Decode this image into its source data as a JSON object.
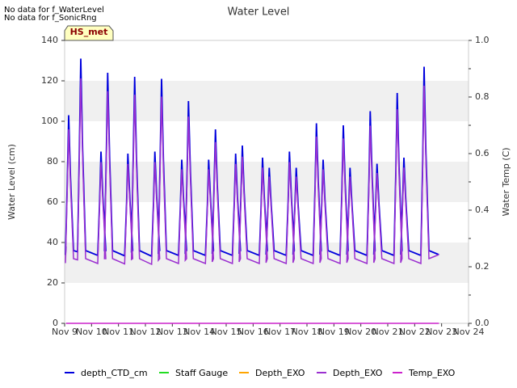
{
  "notices": [
    "No data for f_WaterLevel",
    "No data for f_SonicRng"
  ],
  "badge": "HS_met",
  "colors": {
    "depth_ctd": "#0000dd",
    "staff_gauge": "#22dd22",
    "depth_exo_orange": "#ffa500",
    "depth_exo_purple": "#9b30d0",
    "temp_exo": "#cc22cc",
    "band": "#f0f0f0",
    "badge_bg": "#ffffc0",
    "badge_text": "#8b0000"
  },
  "chart_data": {
    "type": "line",
    "title": "Water Level",
    "xlabel": "",
    "ylabel": "Water Level (cm)",
    "y2label": "Water Temp (C)",
    "ylim": [
      0,
      140
    ],
    "y2lim": [
      0.0,
      1.0
    ],
    "xlim": [
      9,
      24
    ],
    "grid": "horizontal bands",
    "legend_position": "bottom",
    "x_ticks": [
      "Nov 9",
      "Nov 10",
      "Nov 11",
      "Nov 12",
      "Nov 13",
      "Nov 14",
      "Nov 15",
      "Nov 16",
      "Nov 17",
      "Nov 18",
      "Nov 19",
      "Nov 20",
      "Nov 21",
      "Nov 22",
      "Nov 23",
      "Nov 24"
    ],
    "y_ticks": [
      "0",
      "20",
      "40",
      "60",
      "80",
      "100",
      "120",
      "140"
    ],
    "y2_ticks": [
      "0.0",
      "0.2",
      "0.4",
      "0.6",
      "0.8",
      "1.0"
    ],
    "series": [
      {
        "name": "depth_CTD_cm",
        "peaks": [
          {
            "x": 9.15,
            "y": 103,
            "rise": 37
          },
          {
            "x": 9.6,
            "y": 131,
            "rise": 45
          },
          {
            "x": 10.35,
            "y": 85,
            "rise": 36
          },
          {
            "x": 10.6,
            "y": 124,
            "rise": 48
          },
          {
            "x": 11.35,
            "y": 84,
            "rise": 35
          },
          {
            "x": 11.6,
            "y": 122,
            "rise": 46
          },
          {
            "x": 12.35,
            "y": 85,
            "rise": 34
          },
          {
            "x": 12.6,
            "y": 121,
            "rise": 44
          },
          {
            "x": 13.35,
            "y": 81,
            "rise": 36
          },
          {
            "x": 13.6,
            "y": 110,
            "rise": 44
          },
          {
            "x": 14.35,
            "y": 81,
            "rise": 36
          },
          {
            "x": 14.6,
            "y": 96,
            "rise": 40
          },
          {
            "x": 15.35,
            "y": 84,
            "rise": 36
          },
          {
            "x": 15.6,
            "y": 88,
            "rise": 40
          },
          {
            "x": 16.35,
            "y": 82,
            "rise": 36
          },
          {
            "x": 16.6,
            "y": 77,
            "rise": 38
          },
          {
            "x": 17.35,
            "y": 85,
            "rise": 36
          },
          {
            "x": 17.6,
            "y": 77,
            "rise": 38
          },
          {
            "x": 18.35,
            "y": 99,
            "rise": 36
          },
          {
            "x": 18.6,
            "y": 81,
            "rise": 38
          },
          {
            "x": 19.35,
            "y": 98,
            "rise": 36
          },
          {
            "x": 19.6,
            "y": 77,
            "rise": 38
          },
          {
            "x": 20.35,
            "y": 105,
            "rise": 36
          },
          {
            "x": 20.6,
            "y": 79,
            "rise": 38
          },
          {
            "x": 21.35,
            "y": 114,
            "rise": 36
          },
          {
            "x": 21.6,
            "y": 82,
            "rise": 38
          },
          {
            "x": 22.35,
            "y": 127,
            "rise": 36
          }
        ],
        "baseline": 33,
        "x_range": [
          9.05,
          22.9
        ]
      },
      {
        "name": "Staff Gauge",
        "points": []
      },
      {
        "name": "Depth_EXO",
        "points": []
      },
      {
        "name": "Depth_EXO",
        "peak_scale": 0.9
      },
      {
        "name": "Temp_EXO",
        "values_y2": [
          [
            9.05,
            0.0
          ],
          [
            22.9,
            0.0
          ]
        ]
      }
    ]
  }
}
